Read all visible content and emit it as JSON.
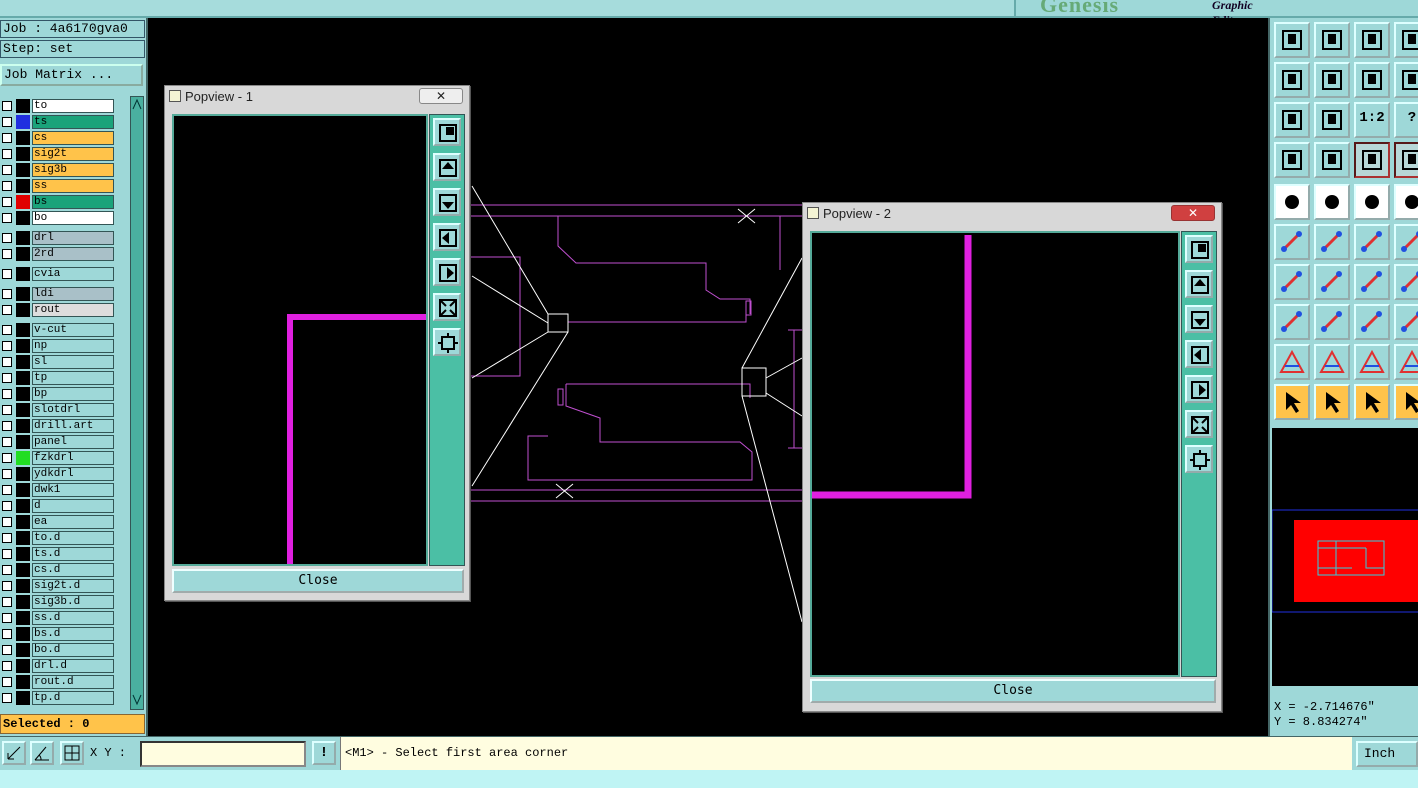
{
  "header": {
    "logo": "Genesis",
    "subtitle": "Graphic Editor"
  },
  "left": {
    "job": "Job : 4a6170gva0",
    "step": "Step: set",
    "job_matrix": "Job Matrix ...",
    "selected": "Selected : 0",
    "layers": [
      {
        "name": "to",
        "color": "#ffffff",
        "swatch": "#000000"
      },
      {
        "name": "ts",
        "color": "#1aa37a",
        "swatch": "#2030e0"
      },
      {
        "name": "cs",
        "color": "#ffc34a",
        "swatch": "#000000"
      },
      {
        "name": "sig2t",
        "color": "#ffc34a",
        "swatch": "#000000"
      },
      {
        "name": "sig3b",
        "color": "#ffc34a",
        "swatch": "#000000"
      },
      {
        "name": "ss",
        "color": "#ffc34a",
        "swatch": "#000000"
      },
      {
        "name": "bs",
        "color": "#1aa37a",
        "swatch": "#e00000"
      },
      {
        "name": "bo",
        "color": "#ffffff",
        "swatch": "#000000"
      },
      {
        "name": "drl",
        "color": "#a9c0c8",
        "swatch": "#000000"
      },
      {
        "name": "2rd",
        "color": "#a9c0c8",
        "swatch": "#000000"
      },
      {
        "name": "cvia",
        "color": "#9ed8d8",
        "swatch": "#000000"
      },
      {
        "name": "ldi",
        "color": "#a9c0c8",
        "swatch": "#000000"
      },
      {
        "name": "rout",
        "color": "#dddddd",
        "swatch": "#000000"
      },
      {
        "name": "v-cut",
        "color": "#9ed8d8",
        "swatch": "#000000"
      },
      {
        "name": "np",
        "color": "#9ed8d8",
        "swatch": "#000000"
      },
      {
        "name": "sl",
        "color": "#9ed8d8",
        "swatch": "#000000"
      },
      {
        "name": "tp",
        "color": "#9ed8d8",
        "swatch": "#000000"
      },
      {
        "name": "bp",
        "color": "#9ed8d8",
        "swatch": "#000000"
      },
      {
        "name": "slotdrl",
        "color": "#9ed8d8",
        "swatch": "#000000"
      },
      {
        "name": "drill.art",
        "color": "#9ed8d8",
        "swatch": "#000000"
      },
      {
        "name": "panel",
        "color": "#9ed8d8",
        "swatch": "#000000"
      },
      {
        "name": "fzkdrl",
        "color": "#9ed8d8",
        "swatch": "#22dd22"
      },
      {
        "name": "ydkdrl",
        "color": "#9ed8d8",
        "swatch": "#000000"
      },
      {
        "name": "dwk1",
        "color": "#9ed8d8",
        "swatch": "#000000"
      },
      {
        "name": "d",
        "color": "#9ed8d8",
        "swatch": "#000000"
      },
      {
        "name": "ea",
        "color": "#9ed8d8",
        "swatch": "#000000"
      },
      {
        "name": "to.d",
        "color": "#9ed8d8",
        "swatch": "#000000"
      },
      {
        "name": "ts.d",
        "color": "#9ed8d8",
        "swatch": "#000000"
      },
      {
        "name": "cs.d",
        "color": "#9ed8d8",
        "swatch": "#000000"
      },
      {
        "name": "sig2t.d",
        "color": "#9ed8d8",
        "swatch": "#000000"
      },
      {
        "name": "sig3b.d",
        "color": "#9ed8d8",
        "swatch": "#000000"
      },
      {
        "name": "ss.d",
        "color": "#9ed8d8",
        "swatch": "#000000"
      },
      {
        "name": "bs.d",
        "color": "#9ed8d8",
        "swatch": "#000000"
      },
      {
        "name": "bo.d",
        "color": "#9ed8d8",
        "swatch": "#000000"
      },
      {
        "name": "drl.d",
        "color": "#9ed8d8",
        "swatch": "#000000"
      },
      {
        "name": "rout.d",
        "color": "#9ed8d8",
        "swatch": "#000000"
      },
      {
        "name": "tp.d",
        "color": "#9ed8d8",
        "swatch": "#000000"
      }
    ]
  },
  "popup1": {
    "title": "Popview - 1",
    "close_x": "✕",
    "close_label": "Close"
  },
  "popup2": {
    "title": "Popview - 2",
    "close_x": "✕",
    "close_label": "Close"
  },
  "right": {
    "ratio_label": "1:2",
    "help_label": "?",
    "coord_x": "X = -2.714676\"",
    "coord_y": "Y = 8.834274\""
  },
  "bottom": {
    "xy_label": "X Y :",
    "xy_value": "",
    "bang": "!",
    "message": "<M1> - Select first area corner",
    "unit": "Inch"
  },
  "colors": {
    "trace": "#e040e0",
    "panel": "#9ed8d8",
    "accent": "#4bbfa5",
    "board": "#ff0000"
  }
}
